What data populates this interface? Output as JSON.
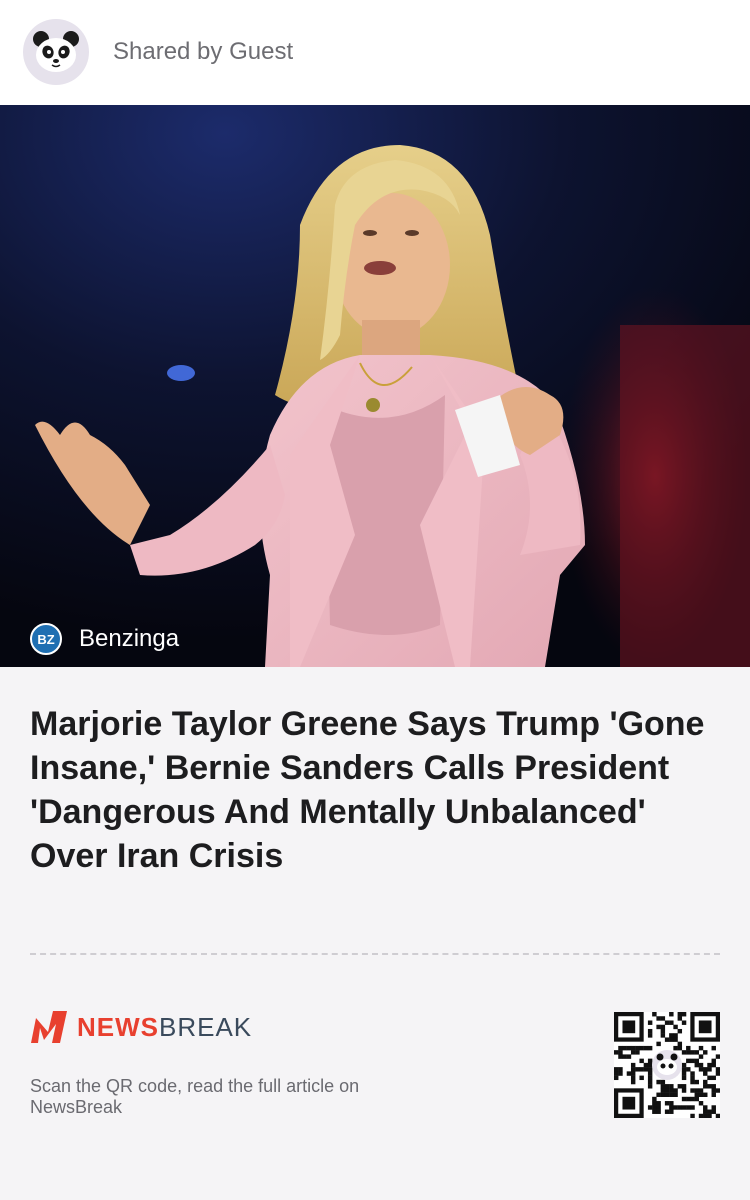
{
  "header": {
    "shared_by": "Shared by Guest",
    "avatar_icon": "panda-icon"
  },
  "article": {
    "source_name": "Benzinga",
    "source_logo_text": "BZ",
    "headline": "Marjorie Taylor Greene Says Trump 'Gone Insane,' Bernie Sanders Calls President 'Dangerous And Mentally Unbalanced' Over Iran Crisis",
    "image_alt": "Woman in pink blazer speaking on stage"
  },
  "footer": {
    "brand_news": "NEWS",
    "brand_break": "BREAK",
    "scan_text": "Scan the QR code, read the full article on NewsBreak",
    "qr_icon": "qr-code-icon"
  },
  "colors": {
    "brand_red": "#e8402f",
    "brand_navy": "#3a4a5c",
    "benzinga_blue": "#1f6fb2",
    "headline": "#1d1d1f",
    "background": "#f5f4f6"
  }
}
